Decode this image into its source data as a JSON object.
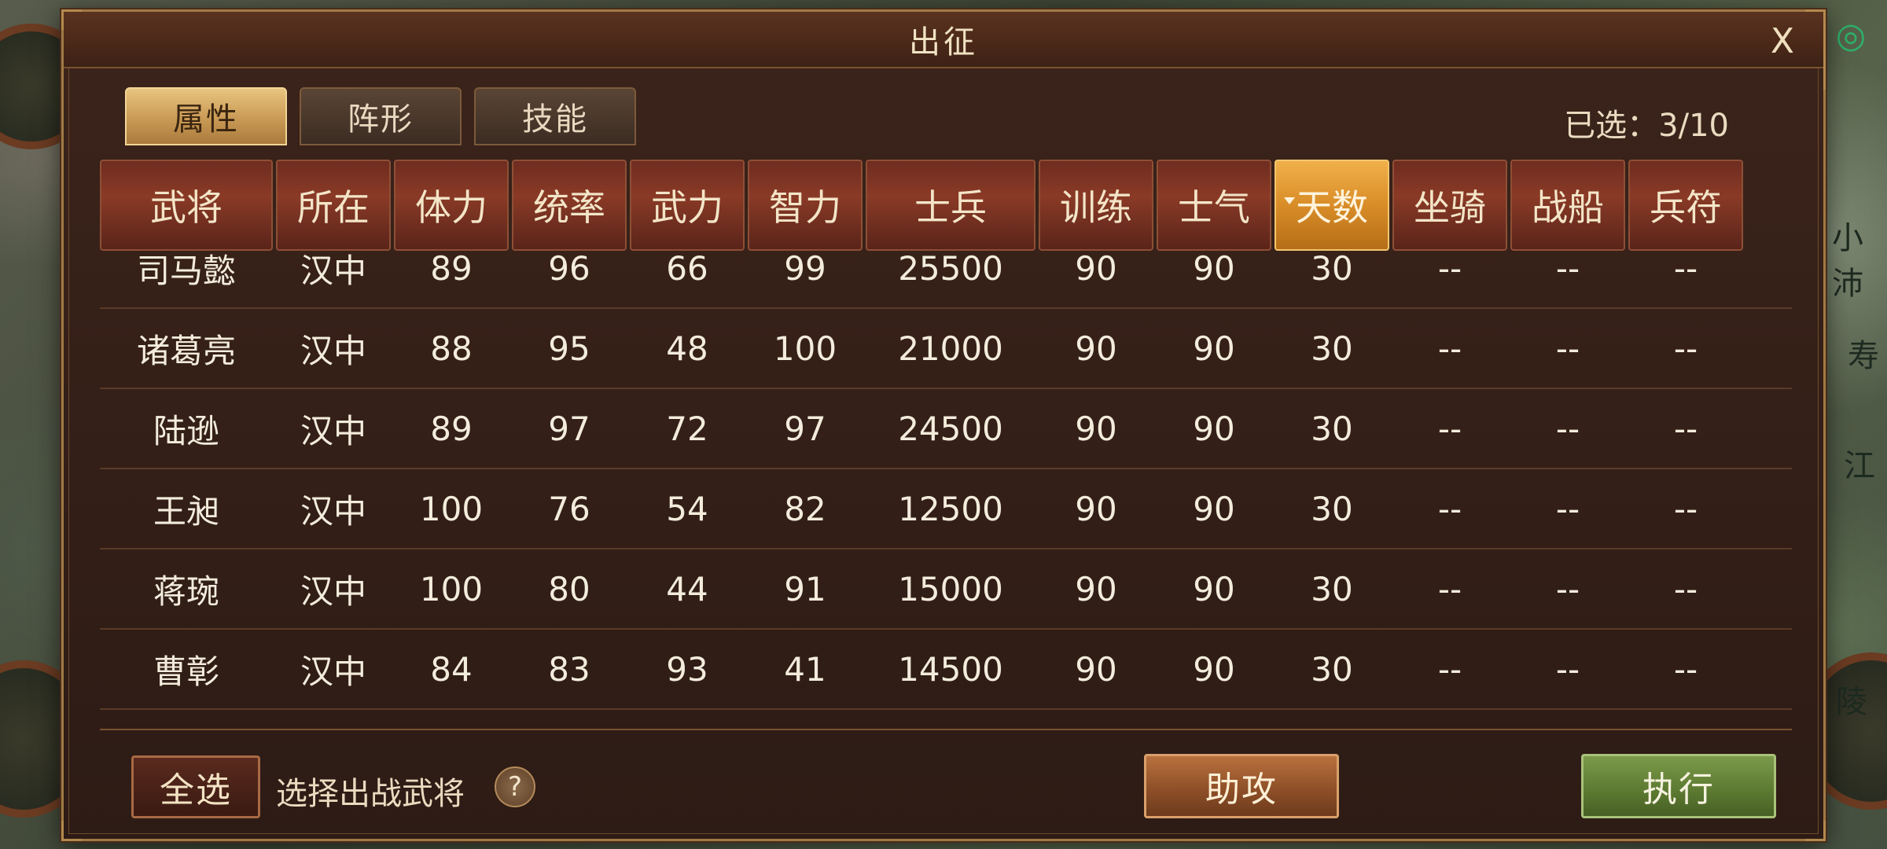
{
  "map": {
    "labels": [
      "小沛",
      "寿",
      "江",
      "陵"
    ]
  },
  "dialog": {
    "title": "出征",
    "close_label": "X"
  },
  "tabs": [
    {
      "label": "属性",
      "active": true
    },
    {
      "label": "阵形",
      "active": false
    },
    {
      "label": "技能",
      "active": false
    }
  ],
  "selected_count": "已选：3/10",
  "table": {
    "columns": [
      "武将",
      "所在",
      "体力",
      "统率",
      "武力",
      "智力",
      "士兵",
      "训练",
      "士气",
      "天数",
      "坐骑",
      "战船",
      "兵符"
    ],
    "sorted_column": "天数",
    "rows": [
      [
        "司马懿",
        "汉中",
        "89",
        "96",
        "66",
        "99",
        "25500",
        "90",
        "90",
        "30",
        "--",
        "--",
        "--"
      ],
      [
        "诸葛亮",
        "汉中",
        "88",
        "95",
        "48",
        "100",
        "21000",
        "90",
        "90",
        "30",
        "--",
        "--",
        "--"
      ],
      [
        "陆逊",
        "汉中",
        "89",
        "97",
        "72",
        "97",
        "24500",
        "90",
        "90",
        "30",
        "--",
        "--",
        "--"
      ],
      [
        "王昶",
        "汉中",
        "100",
        "76",
        "54",
        "82",
        "12500",
        "90",
        "90",
        "30",
        "--",
        "--",
        "--"
      ],
      [
        "蒋琬",
        "汉中",
        "100",
        "80",
        "44",
        "91",
        "15000",
        "90",
        "90",
        "30",
        "--",
        "--",
        "--"
      ],
      [
        "曹彰",
        "汉中",
        "84",
        "83",
        "93",
        "41",
        "14500",
        "90",
        "90",
        "30",
        "--",
        "--",
        "--"
      ]
    ]
  },
  "footer": {
    "select_all_label": "全选",
    "hint": "选择出战武将",
    "help_label": "?",
    "assist_label": "助攻",
    "execute_label": "执行"
  }
}
